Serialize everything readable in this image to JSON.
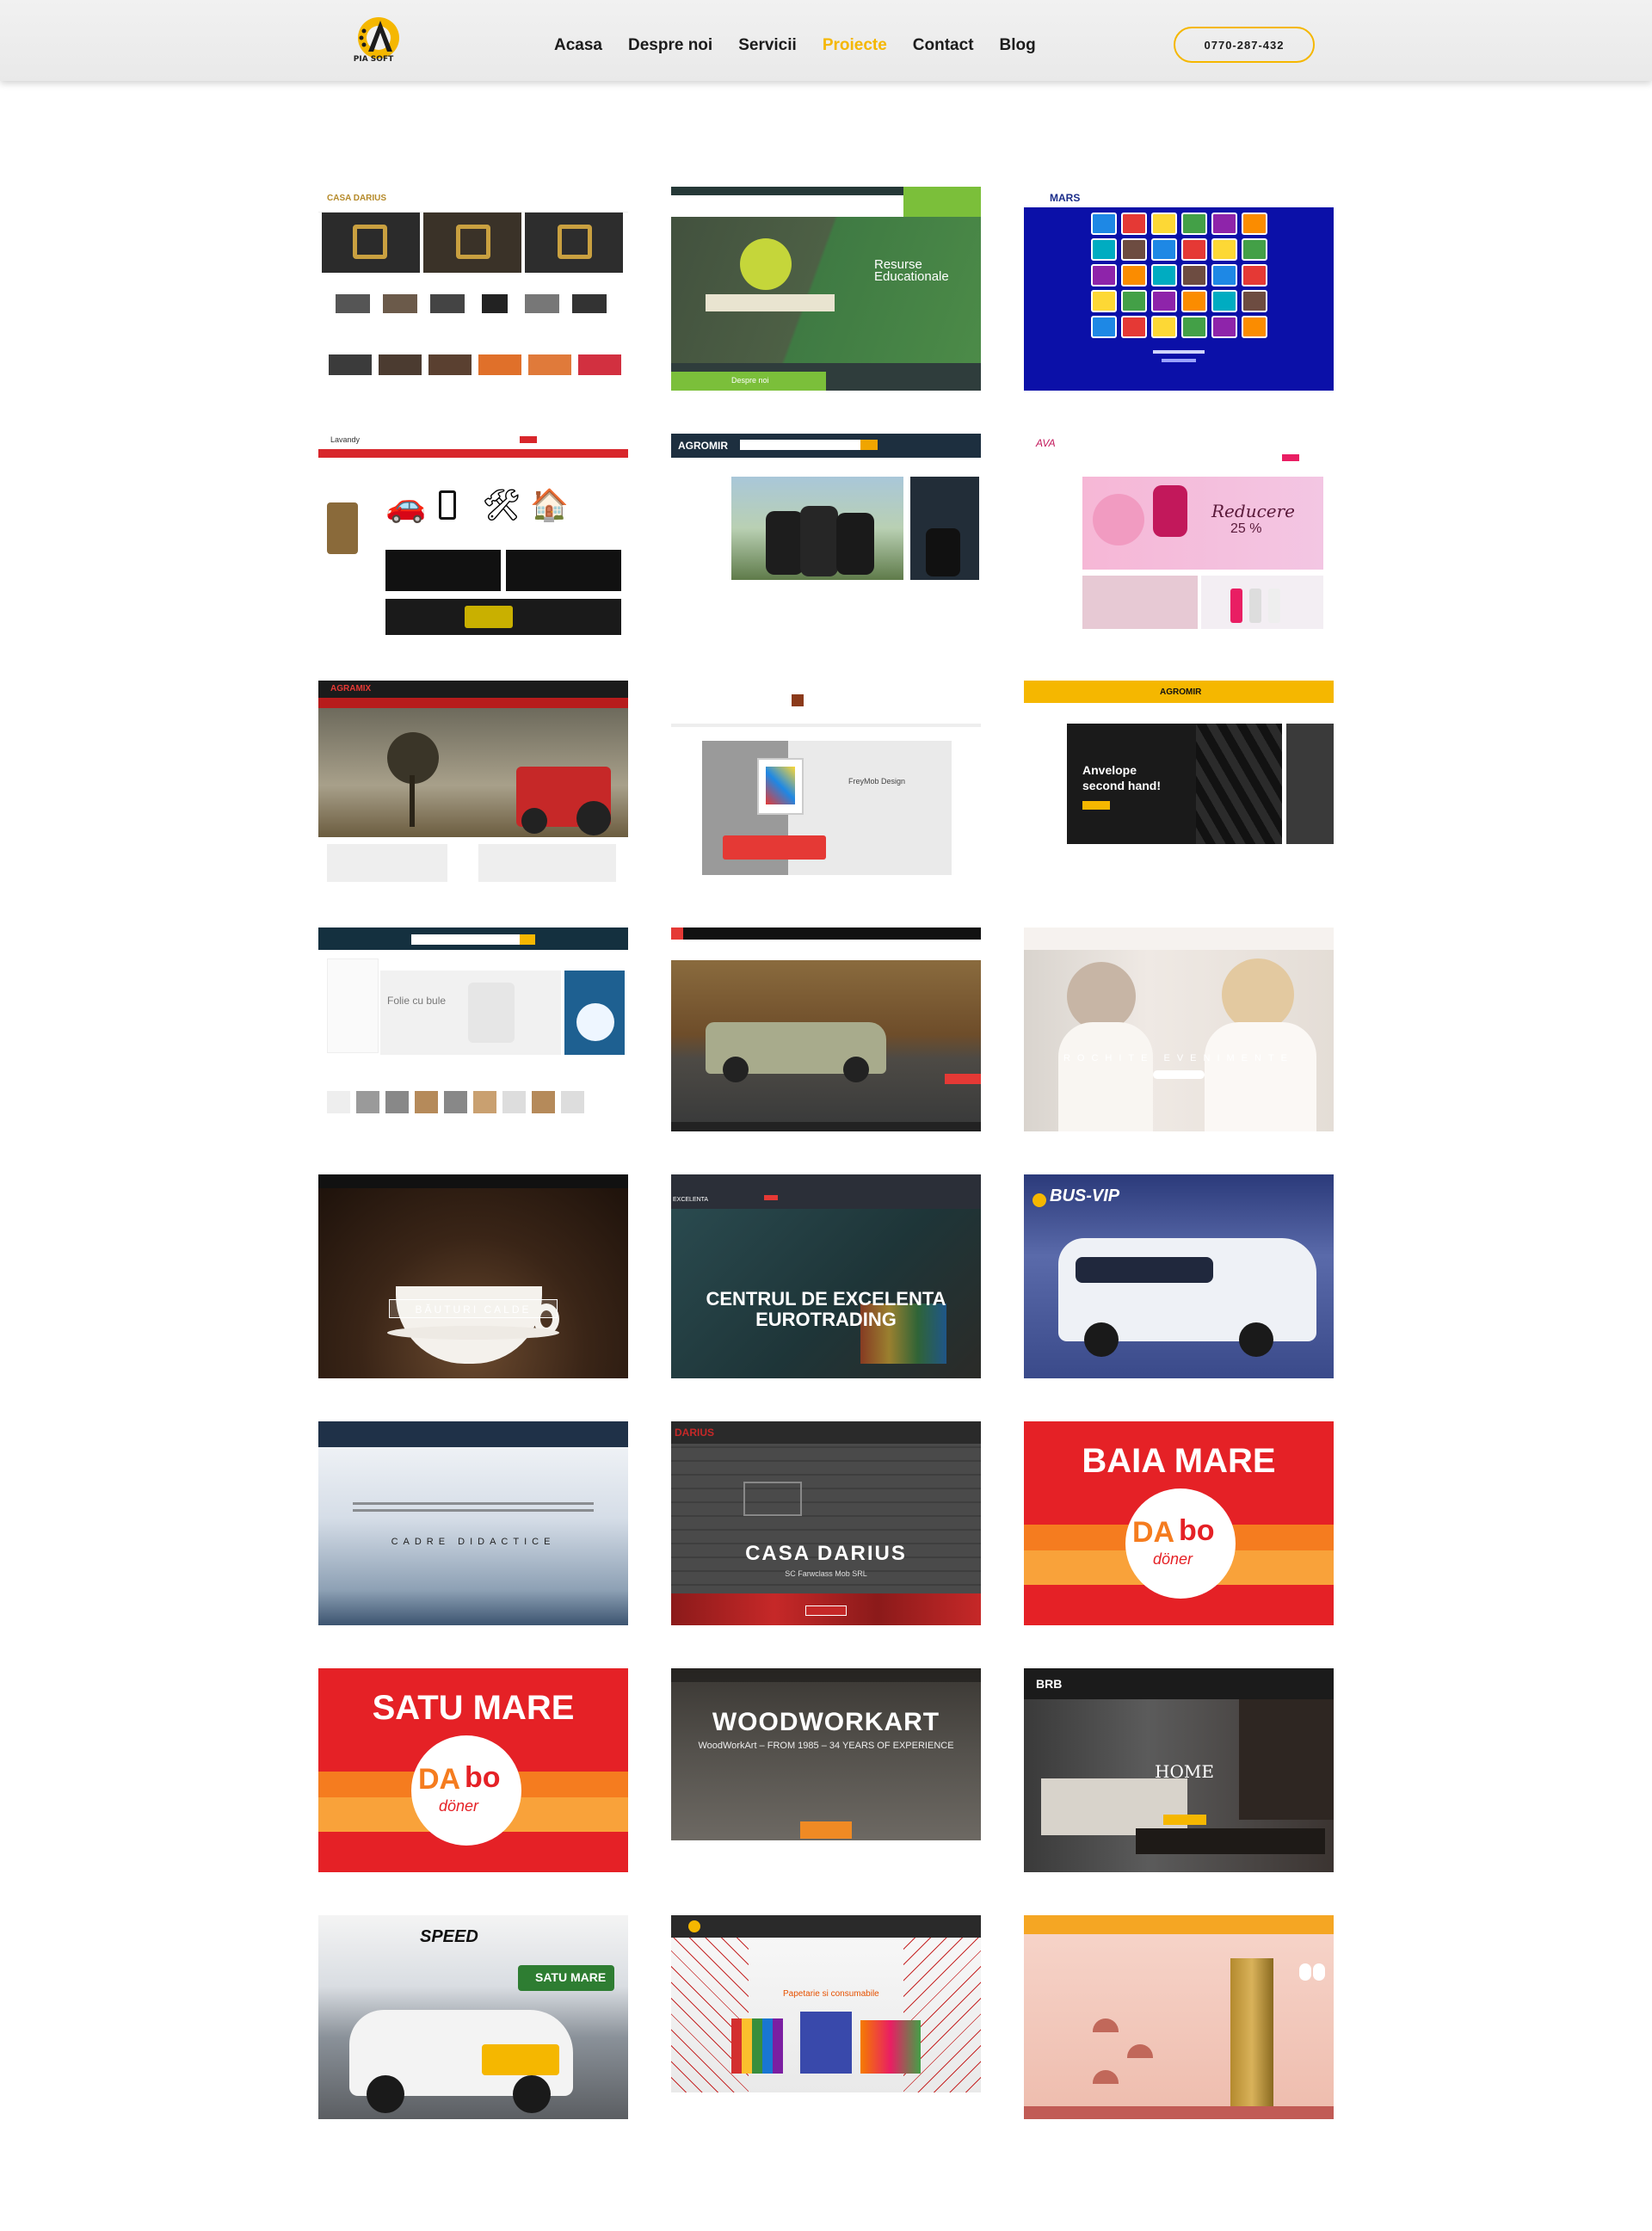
{
  "brand": {
    "logo_text": "PIA SOFT",
    "accent": "#f5b700"
  },
  "nav": {
    "items": [
      {
        "label": "Acasa"
      },
      {
        "label": "Despre noi"
      },
      {
        "label": "Servicii"
      },
      {
        "label": "Proiecte",
        "active": true
      },
      {
        "label": "Contact"
      },
      {
        "label": "Blog"
      }
    ],
    "phone": "0770-287-432"
  },
  "projects": {
    "t1": {
      "logo": "CASA DARIUS"
    },
    "t2": {
      "title_line1": "Resurse",
      "title_line2": "Educationale",
      "button": "Despre noi"
    },
    "t3": {
      "logo": "MARS"
    },
    "t4": {
      "logo": "Lavandy"
    },
    "t5": {
      "logo": "AGROMIR"
    },
    "t6": {
      "logo": "AVA",
      "promo_line1": "Reducere",
      "promo_line2": "25 %"
    },
    "t7": {
      "logo": "AGRAMIX"
    },
    "t8": {
      "caption": "FreyMob Design"
    },
    "t9": {
      "logo": "AGROMIR",
      "title_line1": "Anvelope",
      "title_line2": "second hand!"
    },
    "t10": {
      "banner": "Folie cu bule"
    },
    "t11": {},
    "t12": {
      "caption": "ROCHITE EVENIMENTE"
    },
    "t13": {
      "caption": "BĂUTURI CALDE"
    },
    "t14": {
      "title_line1": "CENTRUL DE EXCELENTA",
      "title_line2": "EUROTRADING",
      "logo": "EXCELENTA"
    },
    "t15": {
      "logo": "BUS-VIP"
    },
    "t16": {
      "caption": "CADRE DIDACTICE"
    },
    "t17": {
      "title": "CASA DARIUS",
      "subtitle": "SC Farwclass Mob SRL",
      "logo": "DARIUS"
    },
    "t18": {
      "city": "BAIA MARE",
      "brand_a": "DA",
      "brand_b": "bo",
      "brand_c": "döner"
    },
    "t19": {
      "city": "SATU MARE",
      "brand_a": "DA",
      "brand_b": "bo",
      "brand_c": "döner"
    },
    "t20": {
      "title": "WOODWORKART",
      "subtitle": "WoodWorkArt – FROM 1985 – 34 YEARS OF EXPERIENCE"
    },
    "t21": {
      "logo": "BRB",
      "caption": "HOME"
    },
    "t22": {
      "brand": "SPEED",
      "sign": "SATU MARE"
    },
    "t23": {
      "caption": "Papetarie si consumabile"
    },
    "t24": {}
  }
}
